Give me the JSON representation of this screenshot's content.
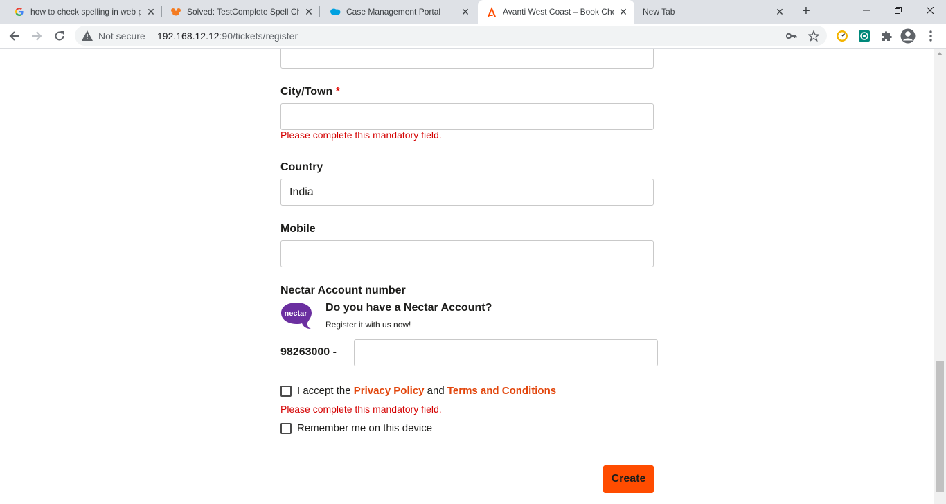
{
  "browser": {
    "tabs": [
      {
        "title": "how to check spelling in web page",
        "favicon": "google-g-icon"
      },
      {
        "title": "Solved: TestComplete Spell Check",
        "favicon": "smartbear-icon"
      },
      {
        "title": "Case Management Portal",
        "favicon": "salesforce-cloud-icon"
      },
      {
        "title": "Avanti West Coast – Book Cheap Trains",
        "favicon": "avanti-icon"
      },
      {
        "title": "New Tab",
        "favicon": ""
      }
    ],
    "active_tab_index": 3,
    "security_label": "Not secure",
    "url_host": "192.168.12.12",
    "url_path": ":90/tickets/register"
  },
  "form": {
    "city_label": "City/Town",
    "required_mark": "*",
    "city_value": "",
    "city_error": "Please complete this mandatory field.",
    "country_label": "Country",
    "country_value": "India",
    "mobile_label": "Mobile",
    "mobile_value": "",
    "nectar": {
      "section_label": "Nectar Account number",
      "logo_text": "nectar",
      "title": "Do you have a Nectar Account?",
      "subtitle": "Register it with us now!",
      "prefix": "98263000 -",
      "value": ""
    },
    "accept_prefix": "I accept the",
    "privacy_link": "Privacy Policy",
    "and_text": "and",
    "terms_link": "Terms and Conditions",
    "accept_error": "Please complete this mandatory field.",
    "remember_label": "Remember me on this device",
    "create_button": "Create"
  },
  "colors": {
    "accent": "#ff4c00",
    "link": "#e2450b",
    "error": "#d40000",
    "nectar_purple": "#6b2fa0"
  }
}
